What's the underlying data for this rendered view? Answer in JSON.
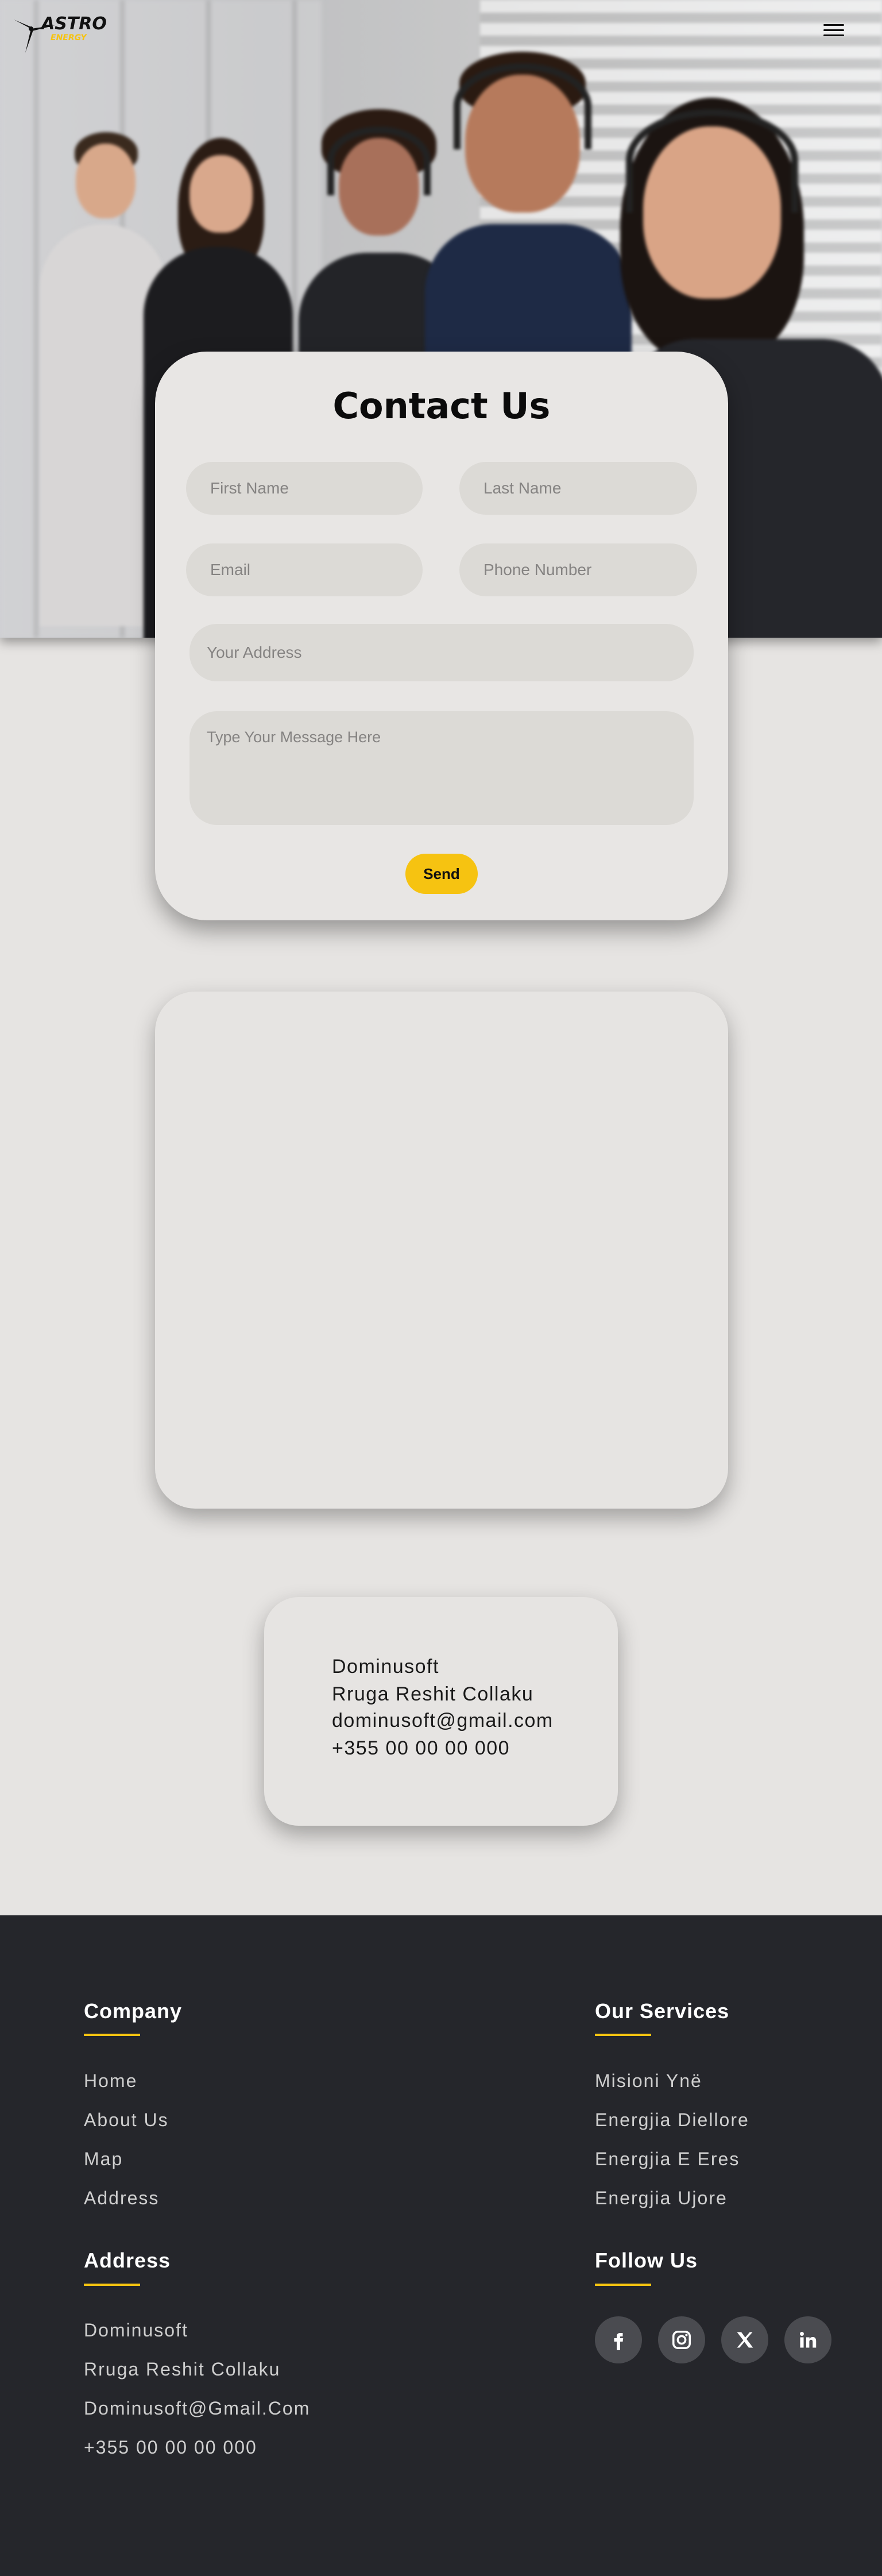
{
  "brand": {
    "name_top": "ASTRO",
    "name_bottom": "ENERGY",
    "accent": "#f6c311"
  },
  "nav": {
    "menu_icon": "hamburger-menu-icon"
  },
  "contact": {
    "title": "Contact Us",
    "first_name_placeholder": "First Name",
    "last_name_placeholder": "Last Name",
    "email_placeholder": "Email",
    "phone_placeholder": "Phone Number",
    "address_placeholder": "Your Address",
    "message_placeholder": "Type Your Message Here",
    "send_label": "Send"
  },
  "info": {
    "company": "Dominusoft",
    "street": "Rruga Reshit Collaku",
    "email": "dominusoft@gmail.com",
    "phone": "+355 00 00 00 000"
  },
  "footer": {
    "company": {
      "heading": "Company",
      "links": [
        "Home",
        "About Us",
        "Map",
        "Address"
      ]
    },
    "services": {
      "heading": "Our Services",
      "links": [
        "Misioni Ynë",
        "Energjia Diellore",
        "Energjia E Eres",
        "Energjia Ujore"
      ]
    },
    "address": {
      "heading": "Address",
      "lines": [
        "Dominusoft",
        "Rruga Reshit Collaku",
        "Dominusoft@Gmail.Com",
        "+355 00 00 00 000"
      ]
    },
    "follow": {
      "heading": "Follow Us",
      "icons": [
        "facebook-icon",
        "instagram-icon",
        "x-icon",
        "linkedin-icon"
      ]
    }
  }
}
